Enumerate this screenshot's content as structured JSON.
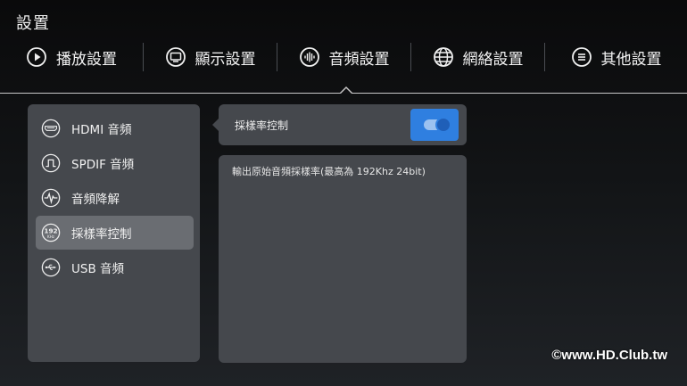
{
  "page": {
    "title": "設置"
  },
  "tabs": [
    {
      "label": "播放設置",
      "icon": "play-icon"
    },
    {
      "label": "顯示設置",
      "icon": "monitor-icon"
    },
    {
      "label": "音頻設置",
      "icon": "audio-wave-icon",
      "active": true
    },
    {
      "label": "網絡設置",
      "icon": "globe-icon"
    },
    {
      "label": "其他設置",
      "icon": "menu-list-icon"
    }
  ],
  "sidebar": {
    "items": [
      {
        "label": "HDMI 音頻",
        "icon": "hdmi-icon"
      },
      {
        "label": "SPDIF 音頻",
        "icon": "spdif-icon"
      },
      {
        "label": "音頻降解",
        "icon": "audio-pulse-icon"
      },
      {
        "label": "採樣率控制",
        "icon": "samplerate-192-icon",
        "active": true
      },
      {
        "label": "USB 音頻",
        "icon": "usb-icon"
      }
    ],
    "samplerate_icon_top": "192",
    "samplerate_icon_bottom": "KHz"
  },
  "option": {
    "label": "採樣率控制",
    "toggle_on": true
  },
  "description": {
    "text": "輸出原始音頻採樣率(最高為 192Khz 24bit)"
  },
  "watermark": {
    "text": "©www.HD.Club.tw"
  },
  "colors": {
    "accent": "#2f7fe0",
    "panel": "#45484d",
    "active_item": "#6a6d72"
  }
}
